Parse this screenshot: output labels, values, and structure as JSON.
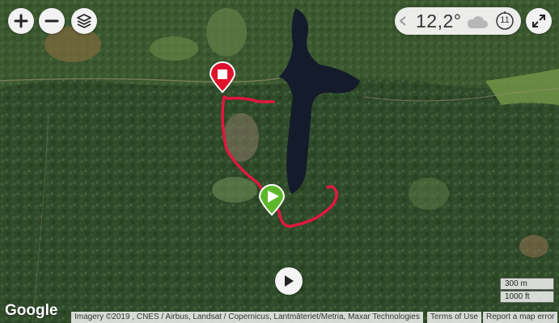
{
  "controls": {
    "zoom_in": "zoom-in-icon",
    "zoom_out": "zoom-out-icon",
    "layers": "layers-icon",
    "fullscreen": "fullscreen-icon",
    "play": "play-icon"
  },
  "weather": {
    "temperature": "12,2°",
    "icon": "cloud-icon",
    "hour": "11"
  },
  "map": {
    "start_marker_color": "#5cb82a",
    "end_marker_color": "#e0112b",
    "track_color": "#e3173f"
  },
  "logo": "Google",
  "attribution": {
    "imagery": "Imagery ©2019 , CNES / Airbus, Landsat / Copernicus, Lantmäteriet/Metria, Maxar Technologies",
    "terms": "Terms of Use",
    "report": "Report a map error"
  },
  "scale": {
    "metric": "300 m",
    "imperial": "1000 ft"
  }
}
